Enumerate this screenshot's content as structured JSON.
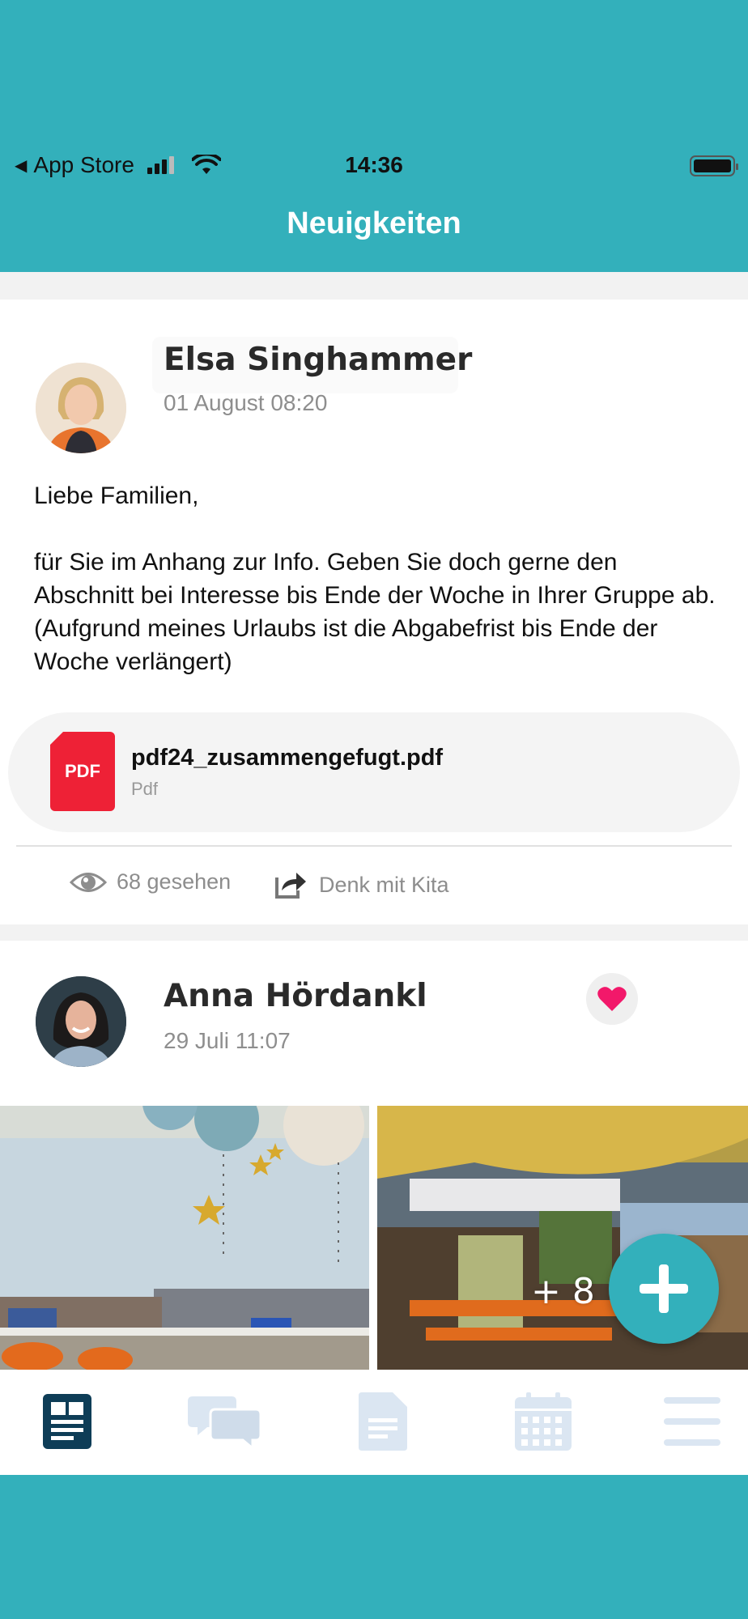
{
  "status_bar": {
    "back_label": "App Store",
    "time": "14:36"
  },
  "header": {
    "title": "Neuigkeiten"
  },
  "posts": [
    {
      "author": "Elsa Singhammer",
      "date": "01 August 08:20",
      "body": [
        "Liebe Familien,",
        "für Sie im Anhang zur Info. Geben Sie doch gerne den Abschnitt bei Interesse bis Ende der Woche in Ihrer Gruppe ab. (Aufgrund meines Urlaubs ist die Abgabefrist bis Ende der Woche verlängert)"
      ],
      "attachment": {
        "icon_label": "PDF",
        "file_name": "pdf24_zusammengefugt.pdf",
        "file_type": "Pdf"
      },
      "seen": "68 gesehen",
      "shared_with": "Denk mit Kita"
    },
    {
      "author": "Anna Hördankl",
      "date": "29 Juli 11:07",
      "liked": true,
      "more_photos": "+ 8"
    }
  ],
  "tab_bar": {
    "tabs": [
      {
        "icon": "news-icon",
        "active": true
      },
      {
        "icon": "chat-icon",
        "active": false
      },
      {
        "icon": "document-icon",
        "active": false
      },
      {
        "icon": "calendar-icon",
        "active": false
      },
      {
        "icon": "menu-icon",
        "active": false
      }
    ]
  },
  "colors": {
    "brand": "#33b0bb",
    "active_tab": "#0e3d57",
    "inactive_tab": "#dbe6f2",
    "heart": "#f2186a",
    "pdf_red": "#ee2136"
  }
}
